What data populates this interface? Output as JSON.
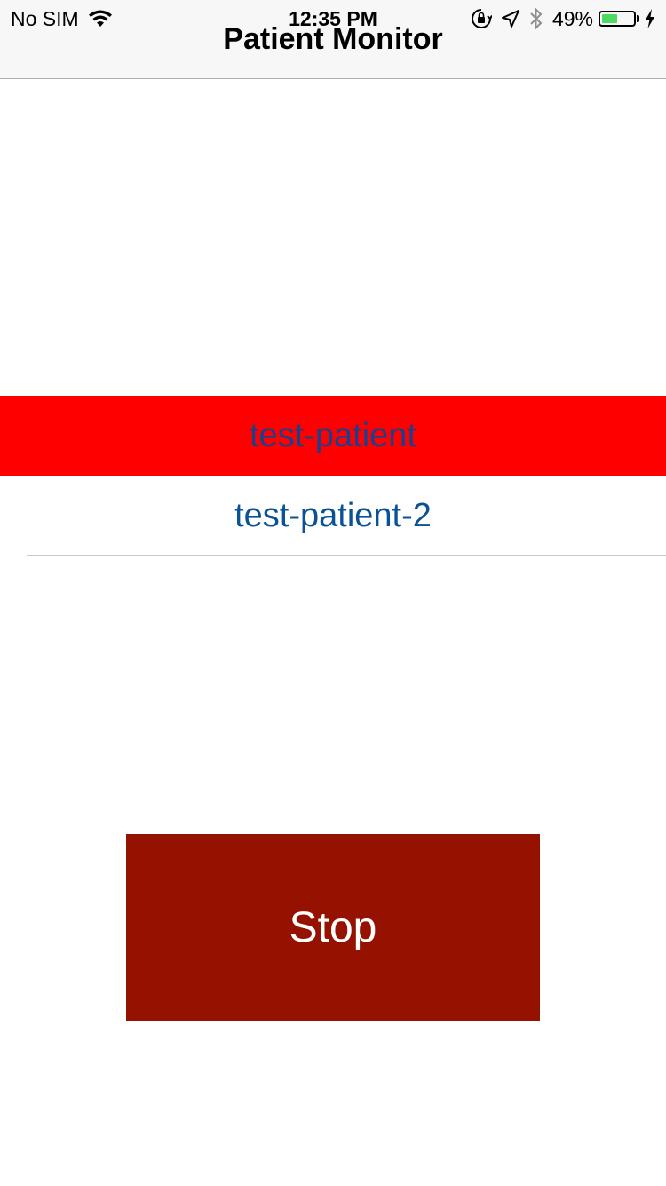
{
  "status_bar": {
    "carrier": "No SIM",
    "time": "12:35 PM",
    "battery_text": "49%",
    "battery_level": 0.49,
    "icons": [
      "wifi-icon",
      "orientation-lock-icon",
      "location-arrow-icon",
      "bluetooth-icon",
      "battery-icon",
      "charging-bolt-icon"
    ]
  },
  "nav": {
    "title": "Patient Monitor"
  },
  "patients": {
    "items": [
      {
        "label": "test-patient",
        "selected": true
      },
      {
        "label": "test-patient-2",
        "selected": false
      }
    ]
  },
  "stop": {
    "label": "Stop"
  },
  "colors": {
    "selected_row_bg": "#ff0000",
    "stop_button_bg": "#961200",
    "patient_text": "#0a5294",
    "battery_fill": "#4cd964"
  }
}
